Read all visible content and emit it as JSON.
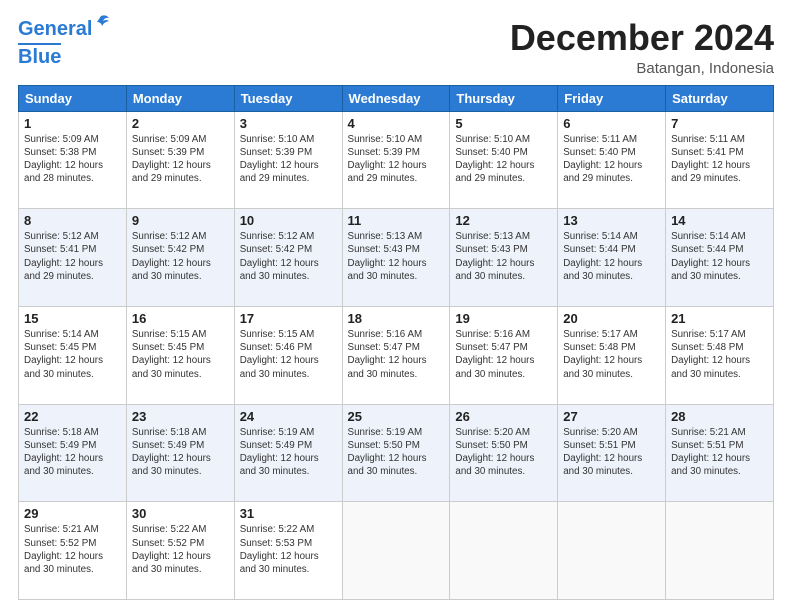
{
  "header": {
    "logo_line1": "General",
    "logo_line2": "Blue",
    "month_title": "December 2024",
    "location": "Batangan, Indonesia"
  },
  "columns": [
    "Sunday",
    "Monday",
    "Tuesday",
    "Wednesday",
    "Thursday",
    "Friday",
    "Saturday"
  ],
  "weeks": [
    [
      {
        "day": "1",
        "sunrise": "5:09 AM",
        "sunset": "5:38 PM",
        "daylight": "12 hours and 28 minutes."
      },
      {
        "day": "2",
        "sunrise": "5:09 AM",
        "sunset": "5:39 PM",
        "daylight": "12 hours and 29 minutes."
      },
      {
        "day": "3",
        "sunrise": "5:10 AM",
        "sunset": "5:39 PM",
        "daylight": "12 hours and 29 minutes."
      },
      {
        "day": "4",
        "sunrise": "5:10 AM",
        "sunset": "5:39 PM",
        "daylight": "12 hours and 29 minutes."
      },
      {
        "day": "5",
        "sunrise": "5:10 AM",
        "sunset": "5:40 PM",
        "daylight": "12 hours and 29 minutes."
      },
      {
        "day": "6",
        "sunrise": "5:11 AM",
        "sunset": "5:40 PM",
        "daylight": "12 hours and 29 minutes."
      },
      {
        "day": "7",
        "sunrise": "5:11 AM",
        "sunset": "5:41 PM",
        "daylight": "12 hours and 29 minutes."
      }
    ],
    [
      {
        "day": "8",
        "sunrise": "5:12 AM",
        "sunset": "5:41 PM",
        "daylight": "12 hours and 29 minutes."
      },
      {
        "day": "9",
        "sunrise": "5:12 AM",
        "sunset": "5:42 PM",
        "daylight": "12 hours and 30 minutes."
      },
      {
        "day": "10",
        "sunrise": "5:12 AM",
        "sunset": "5:42 PM",
        "daylight": "12 hours and 30 minutes."
      },
      {
        "day": "11",
        "sunrise": "5:13 AM",
        "sunset": "5:43 PM",
        "daylight": "12 hours and 30 minutes."
      },
      {
        "day": "12",
        "sunrise": "5:13 AM",
        "sunset": "5:43 PM",
        "daylight": "12 hours and 30 minutes."
      },
      {
        "day": "13",
        "sunrise": "5:14 AM",
        "sunset": "5:44 PM",
        "daylight": "12 hours and 30 minutes."
      },
      {
        "day": "14",
        "sunrise": "5:14 AM",
        "sunset": "5:44 PM",
        "daylight": "12 hours and 30 minutes."
      }
    ],
    [
      {
        "day": "15",
        "sunrise": "5:14 AM",
        "sunset": "5:45 PM",
        "daylight": "12 hours and 30 minutes."
      },
      {
        "day": "16",
        "sunrise": "5:15 AM",
        "sunset": "5:45 PM",
        "daylight": "12 hours and 30 minutes."
      },
      {
        "day": "17",
        "sunrise": "5:15 AM",
        "sunset": "5:46 PM",
        "daylight": "12 hours and 30 minutes."
      },
      {
        "day": "18",
        "sunrise": "5:16 AM",
        "sunset": "5:47 PM",
        "daylight": "12 hours and 30 minutes."
      },
      {
        "day": "19",
        "sunrise": "5:16 AM",
        "sunset": "5:47 PM",
        "daylight": "12 hours and 30 minutes."
      },
      {
        "day": "20",
        "sunrise": "5:17 AM",
        "sunset": "5:48 PM",
        "daylight": "12 hours and 30 minutes."
      },
      {
        "day": "21",
        "sunrise": "5:17 AM",
        "sunset": "5:48 PM",
        "daylight": "12 hours and 30 minutes."
      }
    ],
    [
      {
        "day": "22",
        "sunrise": "5:18 AM",
        "sunset": "5:49 PM",
        "daylight": "12 hours and 30 minutes."
      },
      {
        "day": "23",
        "sunrise": "5:18 AM",
        "sunset": "5:49 PM",
        "daylight": "12 hours and 30 minutes."
      },
      {
        "day": "24",
        "sunrise": "5:19 AM",
        "sunset": "5:49 PM",
        "daylight": "12 hours and 30 minutes."
      },
      {
        "day": "25",
        "sunrise": "5:19 AM",
        "sunset": "5:50 PM",
        "daylight": "12 hours and 30 minutes."
      },
      {
        "day": "26",
        "sunrise": "5:20 AM",
        "sunset": "5:50 PM",
        "daylight": "12 hours and 30 minutes."
      },
      {
        "day": "27",
        "sunrise": "5:20 AM",
        "sunset": "5:51 PM",
        "daylight": "12 hours and 30 minutes."
      },
      {
        "day": "28",
        "sunrise": "5:21 AM",
        "sunset": "5:51 PM",
        "daylight": "12 hours and 30 minutes."
      }
    ],
    [
      {
        "day": "29",
        "sunrise": "5:21 AM",
        "sunset": "5:52 PM",
        "daylight": "12 hours and 30 minutes."
      },
      {
        "day": "30",
        "sunrise": "5:22 AM",
        "sunset": "5:52 PM",
        "daylight": "12 hours and 30 minutes."
      },
      {
        "day": "31",
        "sunrise": "5:22 AM",
        "sunset": "5:53 PM",
        "daylight": "12 hours and 30 minutes."
      },
      null,
      null,
      null,
      null
    ]
  ]
}
